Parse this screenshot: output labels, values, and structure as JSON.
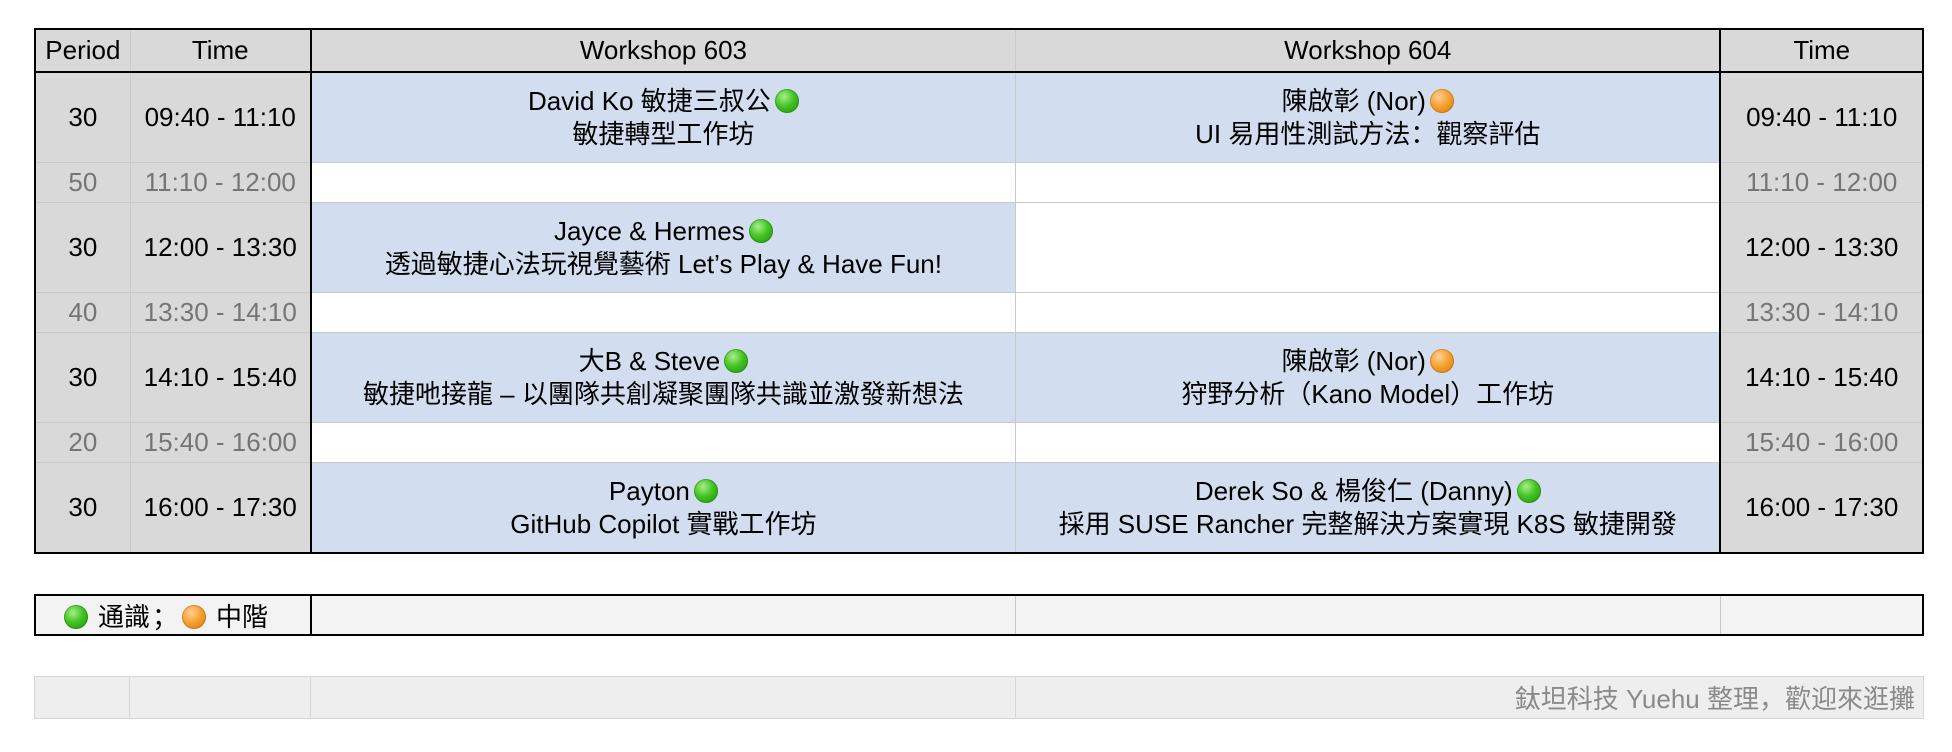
{
  "header": {
    "period": "Period",
    "time": "Time",
    "workshop_603": "Workshop 603",
    "workshop_604": "Workshop 604",
    "time_right": "Time"
  },
  "rows": [
    {
      "kind": "session",
      "period": "30",
      "time": "09:40 - 11:10",
      "ws603": {
        "speaker": "David Ko 敏捷三叔公",
        "level": "green",
        "title": "敏捷轉型工作坊"
      },
      "ws604": {
        "speaker": "陳啟彰 (Nor)",
        "level": "orange",
        "title": "UI 易用性測試方法：觀察評估"
      }
    },
    {
      "kind": "break",
      "period": "50",
      "time": "11:10 - 12:00"
    },
    {
      "kind": "session",
      "period": "30",
      "time": "12:00 - 13:30",
      "ws603": {
        "speaker": "Jayce & Hermes",
        "level": "green",
        "title": "透過敏捷心法玩視覺藝術 Let’s Play & Have Fun!"
      },
      "ws604": null
    },
    {
      "kind": "break",
      "period": "40",
      "time": "13:30 - 14:10"
    },
    {
      "kind": "session",
      "period": "30",
      "time": "14:10 - 15:40",
      "ws603": {
        "speaker": "大B & Steve",
        "level": "green",
        "title": "敏捷吔接龍 – 以團隊共創凝聚團隊共識並激發新想法"
      },
      "ws604": {
        "speaker": "陳啟彰 (Nor)",
        "level": "orange",
        "title": "狩野分析（Kano Model）工作坊"
      }
    },
    {
      "kind": "break",
      "period": "20",
      "time": "15:40 - 16:00"
    },
    {
      "kind": "session",
      "period": "30",
      "time": "16:00 - 17:30",
      "ws603": {
        "speaker": "Payton",
        "level": "green",
        "title": "GitHub Copilot 實戰工作坊"
      },
      "ws604": {
        "speaker": "Derek So & 楊俊仁 (Danny)",
        "level": "green",
        "title": "採用 SUSE Rancher 完整解決方案實現 K8S 敏捷開發"
      }
    }
  ],
  "legend": {
    "general": "通識",
    "separator": "；",
    "intermediate": "中階",
    "green_icon": "green-circle-icon",
    "orange_icon": "orange-circle-icon"
  },
  "footer": {
    "credit": "鈦坦科技 Yuehu 整理，歡迎來逛攤"
  },
  "colors": {
    "session_cell": "#d2deef",
    "header_bg": "#d9d9d9",
    "green_level": "#42c321",
    "orange_level": "#f6a12f"
  }
}
